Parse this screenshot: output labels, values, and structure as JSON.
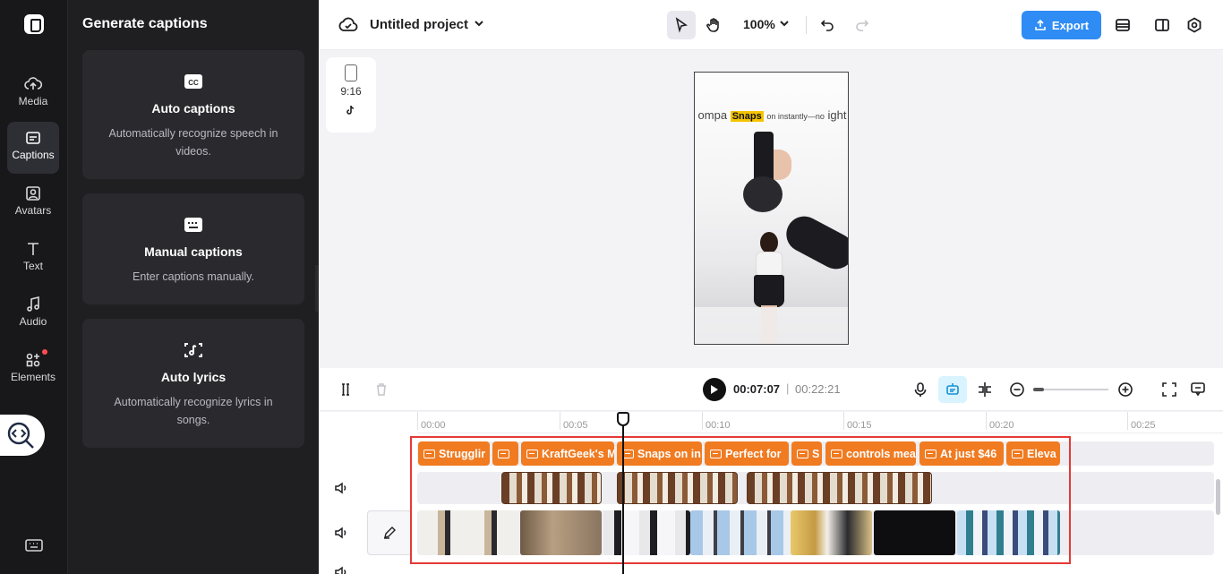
{
  "rail": {
    "items": [
      {
        "label": "Media",
        "icon": "cloud-upload-icon"
      },
      {
        "label": "Captions",
        "icon": "captions-icon",
        "active": true
      },
      {
        "label": "Avatars",
        "icon": "avatar-icon"
      },
      {
        "label": "Text",
        "icon": "text-icon"
      },
      {
        "label": "Audio",
        "icon": "music-note-icon"
      },
      {
        "label": "Elements",
        "icon": "elements-icon",
        "badge": true
      }
    ]
  },
  "panel": {
    "title": "Generate captions",
    "cards": [
      {
        "title": "Auto captions",
        "desc": "Automatically recognize speech in videos.",
        "icon": "cc-icon"
      },
      {
        "title": "Manual captions",
        "desc": "Enter captions manually.",
        "icon": "keyboard-caption-icon"
      },
      {
        "title": "Auto lyrics",
        "desc": "Automatically recognize lyrics in songs.",
        "icon": "lyrics-icon"
      }
    ]
  },
  "topbar": {
    "project_title": "Untitled project",
    "zoom": "100%",
    "export_label": "Export"
  },
  "preview": {
    "ratio": "9:16",
    "overlay_text": "ompa",
    "caption_highlight": "Snaps",
    "caption_rest": "on instantly—no",
    "overlay_tail": "ight"
  },
  "playback": {
    "current": "00:07:07",
    "separator": "|",
    "total": "00:22:21"
  },
  "ruler": [
    "00:00",
    "00:05",
    "00:10",
    "00:15",
    "00:20",
    "00:25"
  ],
  "captions": [
    {
      "text": "Strugglir"
    },
    {
      "text": ""
    },
    {
      "text": "KraftGeek's M"
    },
    {
      "text": "Snaps on in"
    },
    {
      "text": "Perfect for"
    },
    {
      "text": "S"
    },
    {
      "text": "controls mea"
    },
    {
      "text": "At just $46"
    },
    {
      "text": "Eleva"
    }
  ],
  "colors": {
    "accent": "#2f8cf4",
    "caption_clip": "#f07b21",
    "highlight_box": "#e53935"
  }
}
